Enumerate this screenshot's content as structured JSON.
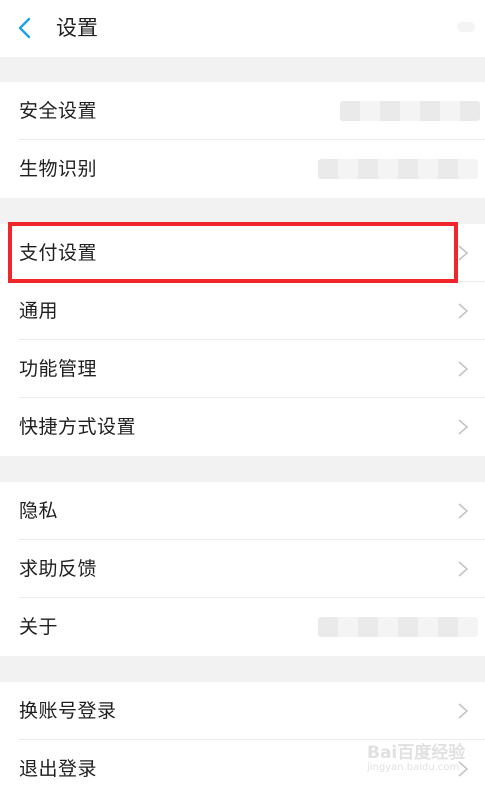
{
  "header": {
    "title": "设置",
    "back_icon": "chevron-left-icon",
    "accent_color": "#1ea0e6"
  },
  "groups": [
    {
      "items": [
        {
          "label": "安全设置",
          "value_obscured": true
        },
        {
          "label": "生物识别",
          "value_obscured": true
        }
      ]
    },
    {
      "items": [
        {
          "label": "支付设置",
          "highlighted": true
        },
        {
          "label": "通用"
        },
        {
          "label": "功能管理"
        },
        {
          "label": "快捷方式设置"
        }
      ]
    },
    {
      "items": [
        {
          "label": "隐私"
        },
        {
          "label": "求助反馈"
        },
        {
          "label": "关于",
          "value_obscured": true
        }
      ]
    },
    {
      "items": [
        {
          "label": "换账号登录"
        },
        {
          "label": "退出登录"
        }
      ]
    }
  ],
  "annotation": {
    "highlight_color": "#f0262a"
  },
  "watermark": {
    "text": "Bai百度经验",
    "url": "jingyan.baidu.com"
  }
}
